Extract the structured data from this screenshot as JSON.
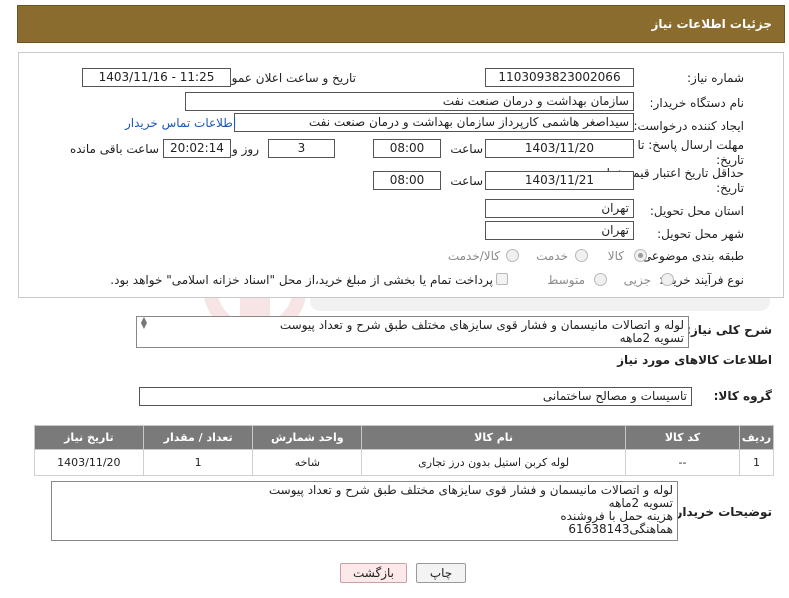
{
  "header": {
    "title": "جزئیات اطلاعات نیاز"
  },
  "form": {
    "need_number_label": "شماره نیاز:",
    "need_number": "1103093823002066",
    "announce_label": "تاریخ و ساعت اعلان عمومی:",
    "announce_value": "1403/11/16 - 11:25",
    "buyer_org_label": "نام دستگاه خریدار:",
    "buyer_org": "سازمان بهداشت و درمان صنعت نفت",
    "creator_label": "ایجاد کننده درخواست:",
    "creator": "سیداصغر هاشمی کارپرداز سازمان بهداشت و درمان صنعت نفت",
    "contact_link": "اطلاعات تماس خریدار",
    "deadline_label_1": "مهلت ارسال پاسخ: تا",
    "deadline_label_2": "تاریخ:",
    "deadline_date": "1403/11/20",
    "time_word": "ساعت",
    "deadline_time": "08:00",
    "days_value": "3",
    "days_and": "روز و",
    "remaining_time": "20:02:14",
    "remaining_label": "ساعت باقی مانده",
    "validity_label_1": "حداقل تاریخ اعتبار قیمت: تا",
    "validity_label_2": "تاریخ:",
    "validity_date": "1403/11/21",
    "validity_time": "08:00",
    "province_label": "استان محل تحویل:",
    "province": "تهران",
    "city_label": "شهر محل تحویل:",
    "city": "تهران",
    "category_label": "طبقه بندی موضوعی:",
    "category_options": [
      "کالا",
      "خدمت",
      "کالا/خدمت"
    ],
    "process_label": "نوع فرآیند خرید :",
    "process_options": [
      "جزیی",
      "متوسط"
    ],
    "payment_note": "پرداخت تمام یا بخشی از مبلغ خرید،از محل \"اسناد خزانه اسلامی\" خواهد بود."
  },
  "description": {
    "label": "شرح کلی نیاز:",
    "text": "لوله و اتصالات مانیسمان و فشار قوی سایزهای مختلف طبق شرح و تعداد پیوست\nتسویه 2ماهه"
  },
  "goods": {
    "section_title": "اطلاعات کالاهای مورد نیاز",
    "group_label": "گروه کالا:",
    "group_value": "تاسیسات و مصالح ساختمانی",
    "columns": [
      "ردیف",
      "کد کالا",
      "نام کالا",
      "واحد شمارش",
      "تعداد / مقدار",
      "تاریخ نیاز"
    ],
    "rows": [
      [
        "1",
        "--",
        "لوله کربن استیل بدون درز تجاری",
        "شاخه",
        "1",
        "1403/11/20"
      ]
    ]
  },
  "buyer_notes": {
    "label": "توضیحات خریدار:",
    "text": "لوله و اتصالات مانیسمان و فشار قوی سایزهای مختلف طبق شرح و تعداد پیوست\nتسویه 2ماهه\nهزینه حمل با فروشنده\nهماهنگی61638143"
  },
  "buttons": {
    "print": "چاپ",
    "back": "بازگشت"
  },
  "colors": {
    "header": "#8a6c2f",
    "table_header": "#7a7a7a",
    "link": "#1a57b8",
    "back_button": "#fde9ea"
  }
}
